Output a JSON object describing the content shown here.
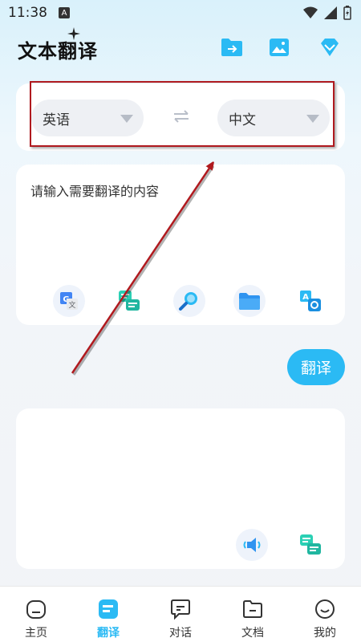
{
  "status_bar": {
    "time": "11:38",
    "notification_letter": "A"
  },
  "header": {
    "title": "文本翻译"
  },
  "language_selector": {
    "source_language": "英语",
    "target_language": "中文"
  },
  "input": {
    "placeholder": "请输入需要翻译的内容",
    "value": ""
  },
  "actions": {
    "translate_label": "翻译"
  },
  "bottom_nav": {
    "items": [
      {
        "label": "主页",
        "active": false
      },
      {
        "label": "翻译",
        "active": true
      },
      {
        "label": "对话",
        "active": false
      },
      {
        "label": "文档",
        "active": false
      },
      {
        "label": "我的",
        "active": false
      }
    ]
  },
  "colors": {
    "accent": "#2bbaf4",
    "highlight_box": "#b0191e",
    "annotation_arrow": "#b0191e"
  }
}
